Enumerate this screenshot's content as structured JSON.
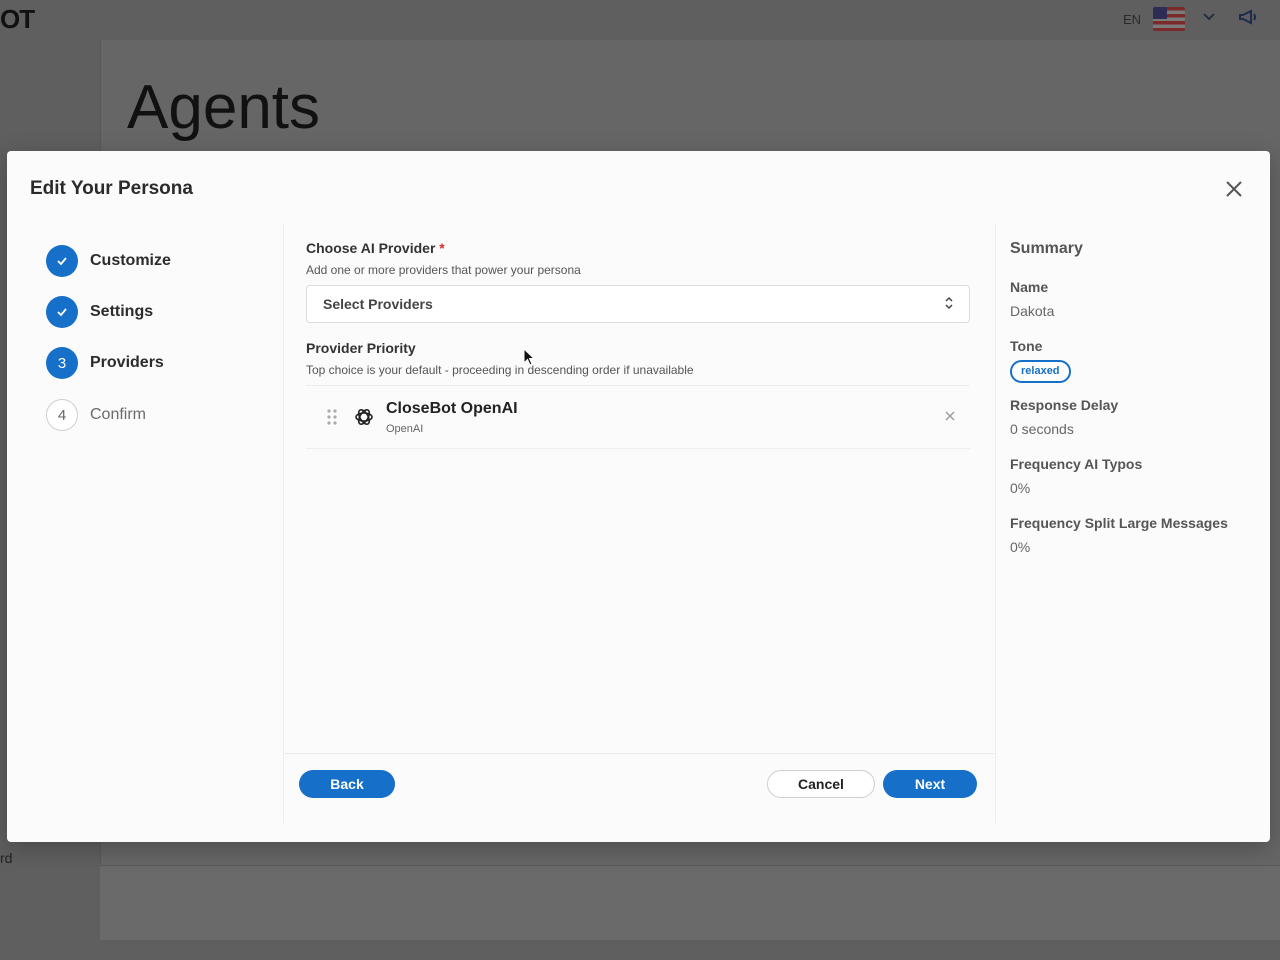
{
  "background": {
    "logo_text": "OT",
    "language": "EN",
    "page_title": "Agents",
    "side_text": "rd"
  },
  "modal": {
    "title": "Edit Your Persona",
    "steps": [
      {
        "label": "Customize",
        "status": "done"
      },
      {
        "label": "Settings",
        "status": "done"
      },
      {
        "label": "Providers",
        "status": "active",
        "number": "3"
      },
      {
        "label": "Confirm",
        "status": "pending",
        "number": "4"
      }
    ],
    "provider_field": {
      "label": "Choose AI Provider",
      "required_mark": "*",
      "help": "Add one or more providers that power your persona",
      "placeholder": "Select Providers"
    },
    "priority": {
      "label": "Provider Priority",
      "help": "Top choice is your default - proceeding in descending order if unavailable",
      "items": [
        {
          "name": "CloseBot OpenAI",
          "provider": "OpenAI",
          "icon": "openai-icon"
        }
      ]
    },
    "summary": {
      "title": "Summary",
      "name_label": "Name",
      "name_value": "Dakota",
      "tone_label": "Tone",
      "tone_value": "relaxed",
      "delay_label": "Response Delay",
      "delay_value": "0 seconds",
      "typos_label": "Frequency AI Typos",
      "typos_value": "0%",
      "split_label": "Frequency Split Large Messages",
      "split_value": "0%"
    },
    "buttons": {
      "back": "Back",
      "cancel": "Cancel",
      "next": "Next"
    }
  },
  "colors": {
    "accent": "#1670c9",
    "required": "#d0312d"
  }
}
